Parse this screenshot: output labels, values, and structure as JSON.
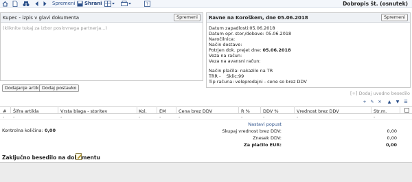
{
  "toolbar": {
    "save_label": "Spremeni",
    "store_label": "Shrani",
    "document_title": "Dobropis št. (osnutek)",
    "help_label": "?",
    "icons": [
      "home-icon",
      "document-icon",
      "binoculars-icon",
      "arrow-left-icon",
      "arrow-right-icon",
      "save-icon",
      "table-icon",
      "print-icon",
      "help-icon"
    ]
  },
  "buyer": {
    "title": "Kupec - izpis v glavi dokumenta",
    "change_label": "Spremeni",
    "placeholder": "(kliknite tukaj za izbor poslovnega partnerja...)"
  },
  "document_info": {
    "title": "Ravne na Koroškem, dne 05.06.2018",
    "change_label": "Spremeni",
    "lines": [
      {
        "label": "Datum zapadlosti:",
        "value": "05.06.2018",
        "bold": false
      },
      {
        "label": "Datum opr. stor./dobave:",
        "value": "05.06.2018",
        "bold": false
      },
      {
        "label": "Naročilnica:",
        "value": "",
        "bold": false
      },
      {
        "label": "Način dostave:",
        "value": "",
        "bold": false
      },
      {
        "label": "Potrjen dok. prejet dne:",
        "value": "05.06.2018",
        "bold": true
      },
      {
        "label": "Veza na račun:",
        "value": "",
        "bold": false
      },
      {
        "label": "Veza na avansni račun:",
        "value": "",
        "bold": false
      }
    ],
    "payment_lines": [
      {
        "label": "Način plačila:",
        "value": "nakazilo na TR"
      },
      {
        "label": "TRR -",
        "value": "Sklic:99"
      },
      {
        "label": "Tip računa:",
        "value": "veleprodajni - cene so brez DDV"
      }
    ]
  },
  "actions": {
    "add_articles": "Dodajanje artiklov",
    "add_item": "Dodaj postavko",
    "add_intro": "[+] Dodaj uvodno besedilo"
  },
  "table": {
    "columns": [
      "#",
      "Šifra artikla",
      "Vrsta blaga - storitev",
      "Kol.",
      "EM",
      "Cena brez DDV",
      "R %",
      "DDV %",
      "Vrednost brez DDV",
      "Str.m."
    ],
    "empty_row": [
      "-",
      "-",
      "-",
      "-",
      "-",
      "-",
      "-",
      "-",
      "-",
      "-"
    ],
    "controls": [
      "+",
      "✎",
      "✕",
      "▲",
      "▼",
      "☰"
    ]
  },
  "totals": {
    "control_qty_label": "Kontrolna količina:",
    "control_qty_value": "0,00",
    "settings_link": "Nastavi popust",
    "net_label": "Skupaj vrednost brez DDV:",
    "net_value": "0,00",
    "amount_label": "Znesek DDV:",
    "amount_value": "0,00",
    "payable_label": "Za plačilo EUR:",
    "payable_value": "0,00"
  },
  "closing": {
    "title": "Zaključno besedilo na dokumentu"
  }
}
